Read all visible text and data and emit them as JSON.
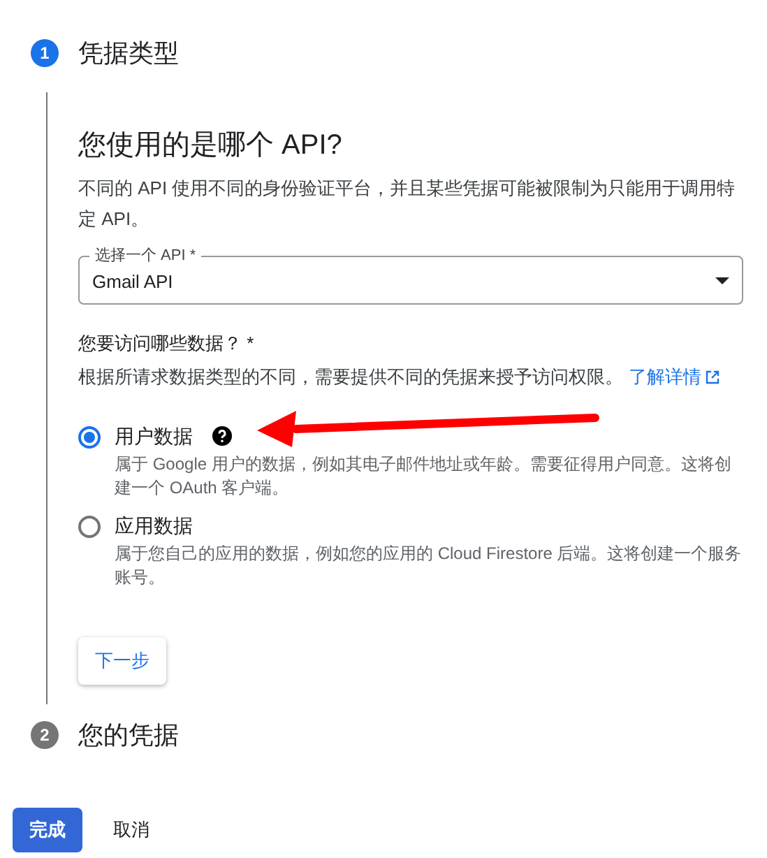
{
  "steps": [
    {
      "number": "1",
      "title": "凭据类型",
      "active": true,
      "content": {
        "heading": "您使用的是哪个 API?",
        "description": "不同的 API 使用不同的身份验证平台，并且某些凭据可能被限制为只能用于调用特定 API。",
        "select": {
          "label": "选择一个 API *",
          "value": "Gmail API"
        },
        "question": "您要访问哪些数据？ *",
        "hint": "根据所请求数据类型的不同，需要提供不同的凭据来授予访问权限。",
        "link": "了解详情",
        "options": [
          {
            "label": "用户数据",
            "selected": true,
            "help": true,
            "description": "属于 Google 用户的数据，例如其电子邮件地址或年龄。需要征得用户同意。这将创建一个 OAuth 客户端。"
          },
          {
            "label": "应用数据",
            "selected": false,
            "help": false,
            "description": "属于您自己的应用的数据，例如您的应用的 Cloud Firestore 后端。这将创建一个服务账号。"
          }
        ],
        "next_button": "下一步"
      }
    },
    {
      "number": "2",
      "title": "您的凭据",
      "active": false
    }
  ],
  "buttons": [
    {
      "label": "完成",
      "kind": "primary"
    },
    {
      "label": "取消",
      "kind": "text"
    }
  ]
}
